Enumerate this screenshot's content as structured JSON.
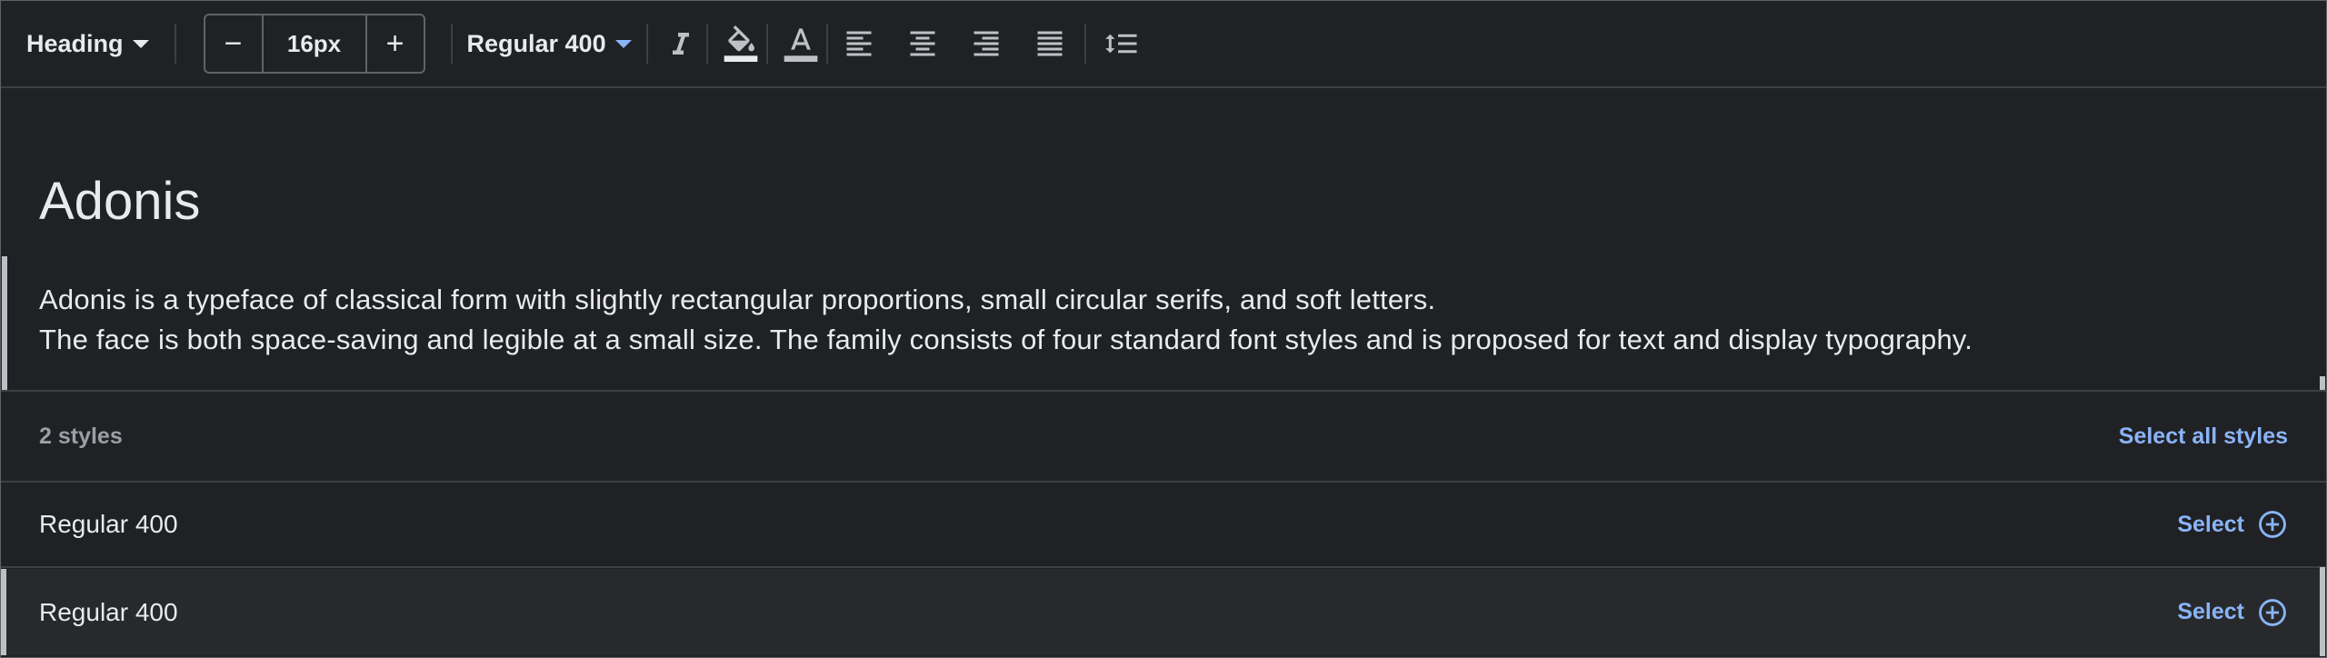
{
  "toolbar": {
    "text_type": "Heading",
    "font_size": "16px",
    "decrease_symbol": "−",
    "increase_symbol": "+",
    "font_weight": "Regular 400",
    "icons": [
      "italic-icon",
      "fill-color-icon",
      "text-color-icon",
      "align-left-icon",
      "align-center-icon",
      "align-right-icon",
      "align-justify-icon",
      "line-height-icon"
    ]
  },
  "preview": {
    "title": "Adonis",
    "line1": "Adonis is a typeface of classical form with slightly rectangular proportions, small circular serifs, and soft letters.",
    "line2": "The face is both space-saving and legible at a small size. The family consists of four standard font styles and is proposed for text and display typography."
  },
  "styles": {
    "count_label": "2 styles",
    "select_all_label": "Select all styles",
    "items": [
      {
        "name": "Regular 400",
        "action": "Select"
      },
      {
        "name": "Regular 400",
        "action": "Select"
      }
    ]
  },
  "colors": {
    "background": "#202124",
    "accent": "#8ab4f8",
    "text": "#e8eaed",
    "muted": "#9aa0a6",
    "border": "#3c4043"
  }
}
